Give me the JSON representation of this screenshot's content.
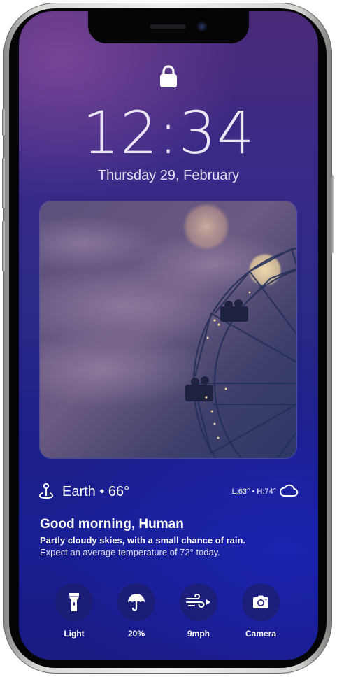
{
  "status": {
    "lock_icon": "lock-icon"
  },
  "lockscreen": {
    "time": "12:34",
    "date": "Thursday 29, February"
  },
  "photo": {
    "icon": "ferris-wheel-photo"
  },
  "weather": {
    "location_icon": "location-pin-icon",
    "location": "Earth • 66°",
    "low_high": "L:63° • H:74°",
    "condition_icon": "cloud-icon"
  },
  "briefing": {
    "greeting": "Good morning, Human",
    "forecast": "Partly cloudy skies, with a small chance of rain.",
    "expectation": "Expect an average temperature of 72° today."
  },
  "actions": [
    {
      "label": "Light",
      "icon": "flashlight-icon"
    },
    {
      "label": "20%",
      "icon": "umbrella-icon"
    },
    {
      "label": "9mph",
      "icon": "wind-icon"
    },
    {
      "label": "Camera",
      "icon": "camera-icon"
    }
  ],
  "colors": {
    "accent": "#2a2a8c",
    "text": "#ffffff"
  }
}
